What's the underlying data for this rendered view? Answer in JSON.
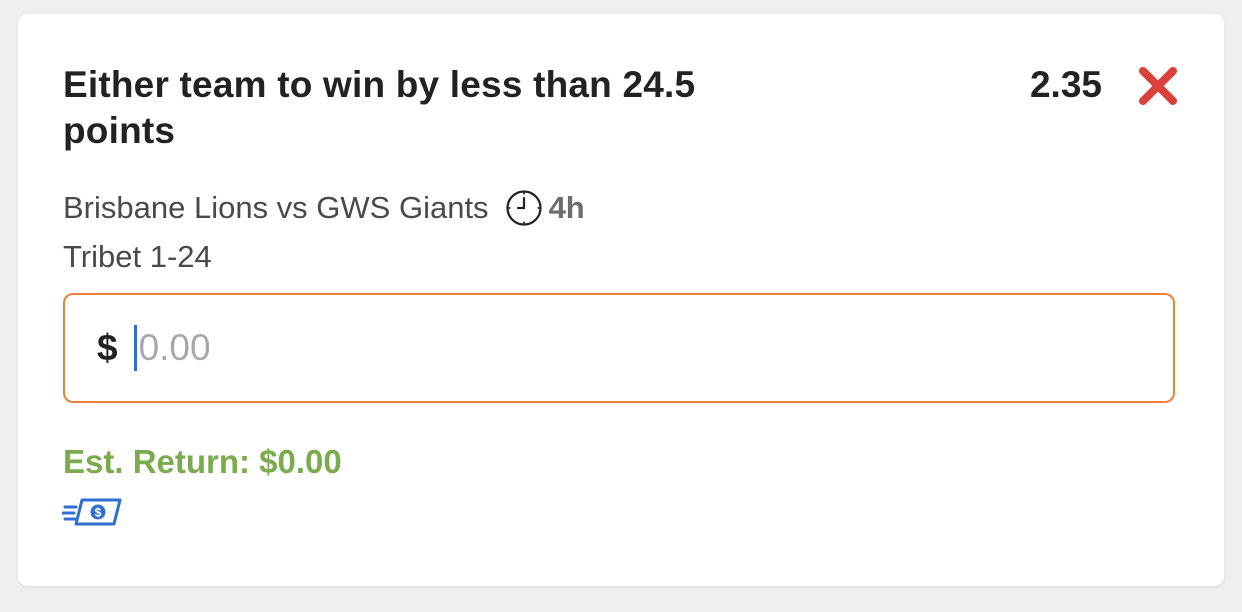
{
  "bet": {
    "title": "Either team to win by less than 24.5 points",
    "odds": "2.35",
    "match": "Brisbane Lions vs GWS Giants",
    "time_to_start": "4h",
    "market": "Tribet 1-24"
  },
  "stake": {
    "currency_symbol": "$",
    "value": "",
    "placeholder": "0.00"
  },
  "est_return": {
    "text": "Est. Return: $0.00"
  },
  "icons": {
    "remove": "close-x-icon",
    "clock": "clock-icon",
    "cash": "cash-rewards-icon"
  },
  "colors": {
    "remove": "#d9413a",
    "input_border": "#e8823a",
    "est_return": "#7aab4c",
    "cash_icon": "#2f6fd0"
  }
}
